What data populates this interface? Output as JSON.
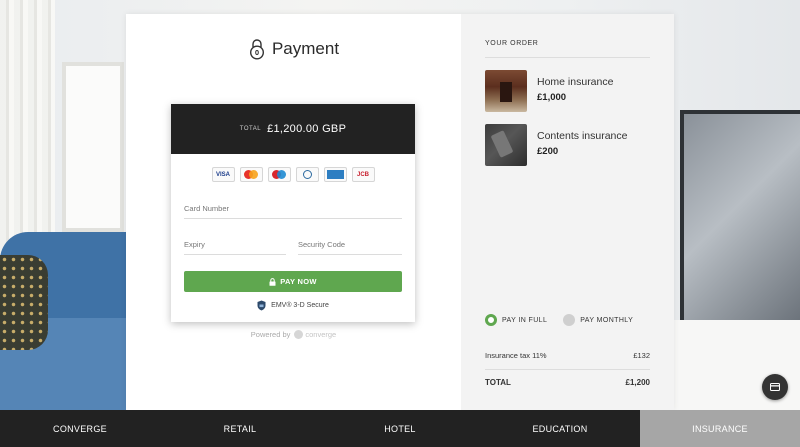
{
  "payment": {
    "title": "Payment",
    "total_label": "TOTAL",
    "total_amount": "£1,200.00 GBP",
    "card_brands": [
      "VISA",
      "mastercard-icon",
      "maestro-icon",
      "diners-icon",
      "amex-icon",
      "JCB"
    ],
    "fields": {
      "card_number_placeholder": "Card Number",
      "expiry_placeholder": "Expiry",
      "security_code_placeholder": "Security Code"
    },
    "pay_button_label": "PAY NOW",
    "emv_label": "EMV® 3-D Secure",
    "powered_by": "Powered by",
    "powered_logo": "converge"
  },
  "order": {
    "heading": "YOUR ORDER",
    "items": [
      {
        "name": "Home insurance",
        "price": "£1,000",
        "thumb": "home-photo"
      },
      {
        "name": "Contents insurance",
        "price": "£200",
        "thumb": "contents-photo"
      }
    ],
    "plan_options": [
      {
        "label": "PAY IN FULL",
        "selected": true
      },
      {
        "label": "PAY MONTHLY",
        "selected": false
      }
    ],
    "tax_label": "Insurance tax 11%",
    "tax_value": "£132",
    "total_label": "TOTAL",
    "total_value": "£1,200"
  },
  "nav": {
    "tabs": [
      {
        "label": "CONVERGE",
        "active": false
      },
      {
        "label": "RETAIL",
        "active": false
      },
      {
        "label": "HOTEL",
        "active": false
      },
      {
        "label": "EDUCATION",
        "active": false
      },
      {
        "label": "INSURANCE",
        "active": true
      }
    ]
  },
  "colors": {
    "accent_green": "#5fa74f",
    "dark_bar": "#222222",
    "active_tab": "#a6a6a6"
  }
}
